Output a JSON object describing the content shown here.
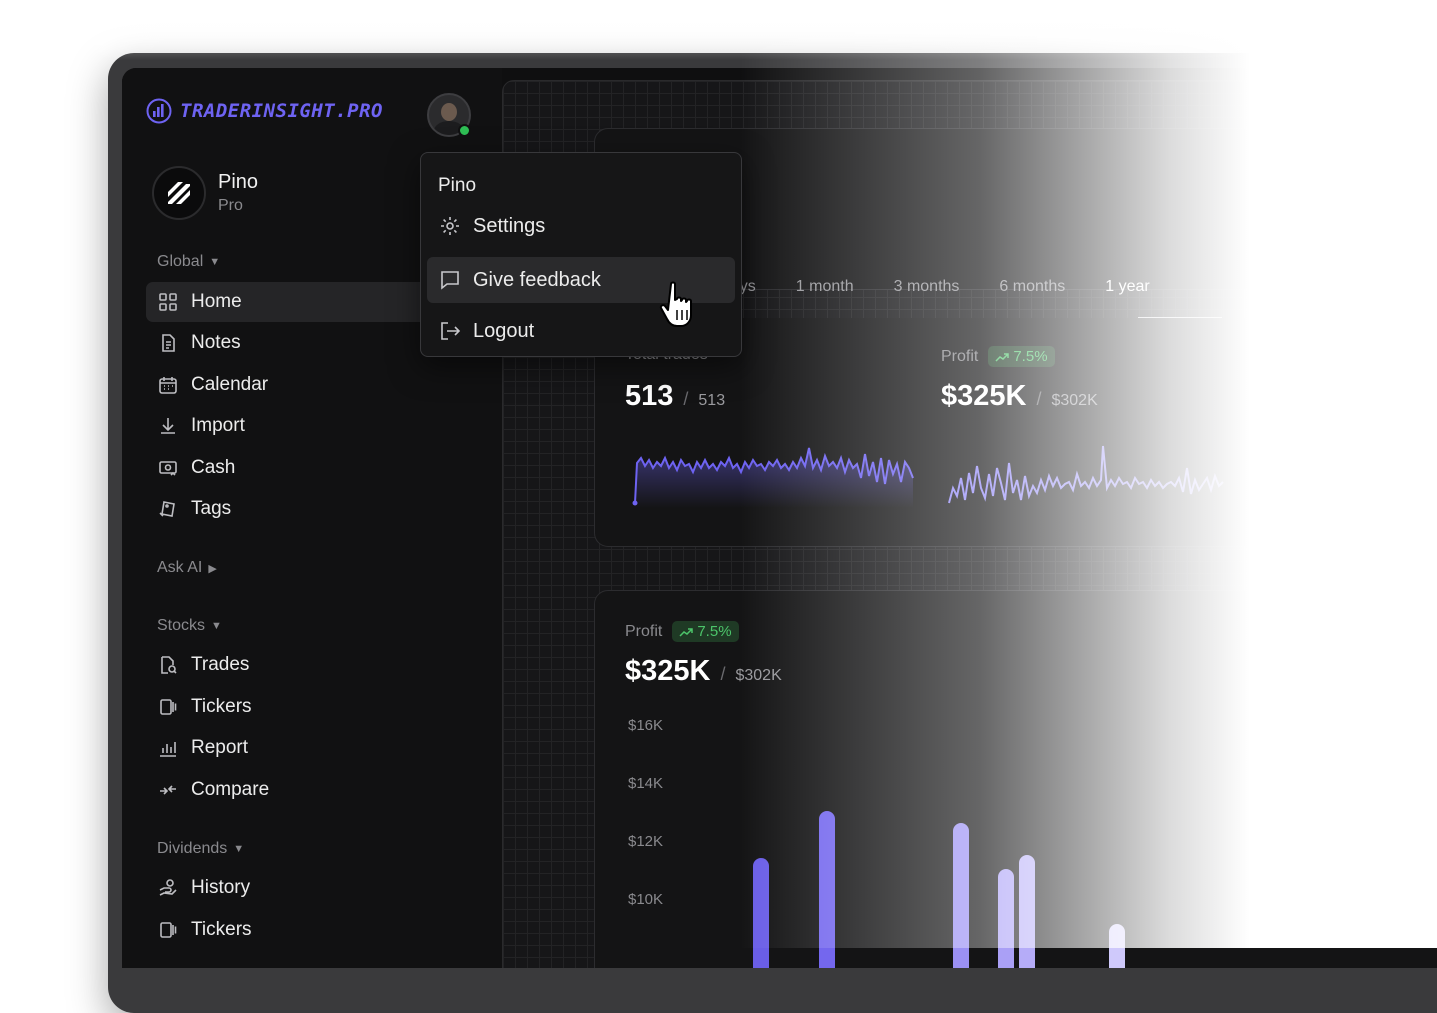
{
  "brand": {
    "name": "TRADERINSIGHT.PRO",
    "accent": "#6e63f2"
  },
  "profile": {
    "name": "Pino",
    "plan": "Pro"
  },
  "sidebar": {
    "global_label": "Global",
    "global_items": [
      {
        "label": "Home",
        "icon": "grid-icon"
      },
      {
        "label": "Notes",
        "icon": "document-icon"
      },
      {
        "label": "Calendar",
        "icon": "calendar-icon"
      },
      {
        "label": "Import",
        "icon": "download-icon"
      },
      {
        "label": "Cash",
        "icon": "cash-icon"
      },
      {
        "label": "Tags",
        "icon": "tag-icon"
      }
    ],
    "ask_ai_label": "Ask AI",
    "stocks_label": "Stocks",
    "stocks_items": [
      {
        "label": "Trades",
        "icon": "doc-search-icon"
      },
      {
        "label": "Tickers",
        "icon": "ticker-icon"
      },
      {
        "label": "Report",
        "icon": "bar-chart-icon"
      },
      {
        "label": "Compare",
        "icon": "compare-icon"
      }
    ],
    "dividends_label": "Dividends",
    "dividends_items": [
      {
        "label": "History",
        "icon": "hand-coins-icon"
      },
      {
        "label": "Tickers",
        "icon": "ticker-icon"
      }
    ]
  },
  "menu": {
    "name": "Pino",
    "items": [
      {
        "label": "Settings",
        "icon": "gear-icon"
      },
      {
        "label": "Give feedback",
        "icon": "message-icon"
      },
      {
        "label": "Logout",
        "icon": "logout-icon"
      }
    ]
  },
  "tabs": [
    "days",
    "1 month",
    "3 months",
    "6 months",
    "1 year"
  ],
  "stats": {
    "trades_label": "Total trades",
    "trades_value": "513",
    "trades_total": "513",
    "profit_label": "Profit",
    "profit_change": "7.5%",
    "profit_value": "$325K",
    "profit_prev": "$302K"
  },
  "chart_data": {
    "type": "bar",
    "title": "Profit",
    "ylabel": "",
    "xlabel": "",
    "y_ticks": [
      "$16K",
      "$14K",
      "$12K",
      "$10K"
    ],
    "ylim": [
      9000,
      17000
    ],
    "series": [
      {
        "values": [
          11500,
          13100,
          12700,
          11100,
          11600,
          9200
        ],
        "colors": [
          "#6a5ee6",
          "#7467ee",
          "#9b90f4",
          "#aaa0f6",
          "#b5acf8",
          "#cfc9fb"
        ]
      }
    ]
  }
}
